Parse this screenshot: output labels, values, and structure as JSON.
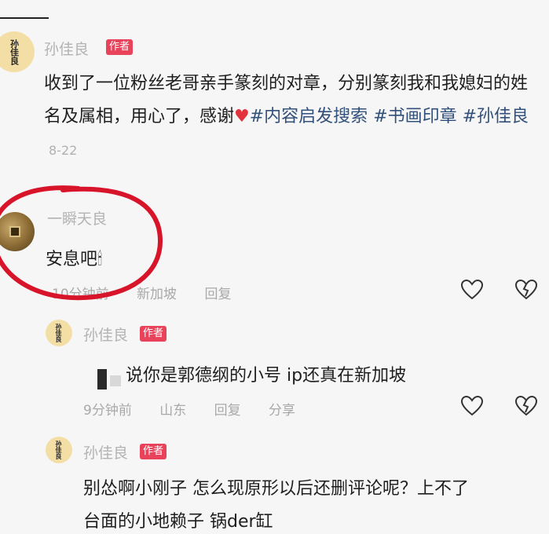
{
  "post": {
    "author_name": "孙佳良",
    "author_badge": "作者",
    "avatar_text": "孙佳良",
    "text_part1": "收到了一位粉丝老哥亲手篆刻的对章，分别篆刻我和我媳妇的姓名及属相，用心了，感谢",
    "heart_emoji": "♥",
    "tag1": "#内容启发搜索",
    "tag2": "#书画印章",
    "tag3": "#孙佳良",
    "time": "8-22"
  },
  "comment1": {
    "author_name": "一瞬天良",
    "text": "安息吧🕯",
    "meta_time": "10分钟前",
    "meta_location": "新加坡",
    "reply_label": "回复"
  },
  "reply1": {
    "author_name": "孙佳良",
    "author_badge": "作者",
    "avatar_text": "孙佳良",
    "text": "说你是郭德纲的小号 ip还真在新加坡",
    "meta_time": "9分钟前",
    "meta_location": "山东",
    "reply_label": "回复",
    "share_label": "分享"
  },
  "reply2": {
    "author_name": "孙佳良",
    "author_badge": "作者",
    "avatar_text": "孙佳良",
    "text_line1": "别怂啊小刚子 怎么现原形以后还删评论呢？上不了",
    "text_line2": "台面的小地赖子 锅der缸"
  },
  "icons": {
    "like": "heart-outline-icon",
    "dislike": "broken-heart-icon"
  },
  "colors": {
    "badge": "#e9425b",
    "annotation_ring": "#d8142a",
    "tag": "#31507a"
  }
}
